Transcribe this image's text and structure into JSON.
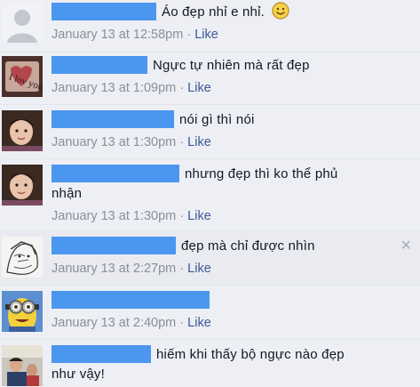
{
  "comments": [
    {
      "text": "Áo đẹp nhỉ e nhỉ.",
      "emoji": "smiley-icon",
      "time": "January 13 at 12:58pm",
      "separator": "·",
      "like": "Like"
    },
    {
      "text": "Ngực tự nhiên mà rất đẹp",
      "avatar_text": "I lov you",
      "time": "January 13 at 1:09pm",
      "separator": "·",
      "like": "Like"
    },
    {
      "text": "nói gì thì nói",
      "time": "January 13 at 1:30pm",
      "separator": "·",
      "like": "Like"
    },
    {
      "text": "nhưng đẹp thì ko thể phủ",
      "text2": "nhận",
      "time": "January 13 at 1:30pm",
      "separator": "·",
      "like": "Like"
    },
    {
      "text": "đẹp mà chỉ được nhìn",
      "time": "January 13 at 2:27pm",
      "separator": "·",
      "like": "Like",
      "close": "×"
    },
    {
      "text": "",
      "time": "January 13 at 2:40pm",
      "separator": "·",
      "like": "Like"
    },
    {
      "text": "hiếm khi thấy bộ ngực nào đẹp",
      "text2": "như vậy!",
      "time": "",
      "separator": "",
      "like": ""
    }
  ],
  "colors": {
    "redaction": "#4b96ee",
    "link": "#3b5998",
    "meta": "#8a8f99",
    "background": "#edeff4"
  }
}
